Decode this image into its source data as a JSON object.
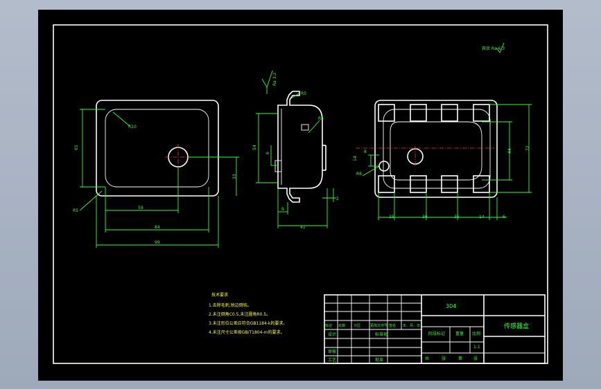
{
  "views": {
    "front": {
      "radius_label": "R10",
      "dim_height_outer": "65",
      "dim_height_inner": "33",
      "dim_hole_x": "59",
      "dim_inner_width": "84",
      "dim_overall_width": "99",
      "radius_corner": "R5"
    },
    "side": {
      "roughness": "Ra 3.2",
      "radius_top": "R5",
      "radius_inner": "R5",
      "dim_height": "54",
      "dim_pitch": "6",
      "dim_thickness": "2",
      "dim_flange": "9",
      "dim_depth": "41"
    },
    "rear": {
      "dim_8": "8",
      "dim_14": "14",
      "dim_hole": "R8",
      "dim_44": "44",
      "dim_72": "72",
      "dim_25": "25",
      "dim_36a": "36",
      "dim_36b": "36",
      "dim_14b": "14",
      "dim_6": "6"
    }
  },
  "general_roughness": "其余 Ra 6.3",
  "tech_requirements": {
    "title": "技术要求",
    "items": [
      "1.去除毛刺,锐边倒钝。",
      "2.未注倒角C0.5,未注圆角R0.5。",
      "3.未注形位公差应符合GB1184-k的要求。",
      "4.未注尺寸公差按GB/T1804-m的要求。"
    ]
  },
  "title_block": {
    "material": "304",
    "part_name": "传感器盒",
    "rev_headers": [
      "标记",
      "处数",
      "分区",
      "更改文件号",
      "签名",
      "年、月、日"
    ],
    "designer_label": "设计",
    "standardization_label": "标准化",
    "review_label": "审核",
    "process_label": "工艺",
    "approve_label": "批准",
    "stage_label": "阶段标记",
    "weight_label": "重量",
    "scale_label": "比例",
    "scale_value": "1:1",
    "sheet_total_label": "共",
    "sheet_label": "张",
    "sheet_no_label": "第",
    "sheet_no_unit": "张"
  }
}
